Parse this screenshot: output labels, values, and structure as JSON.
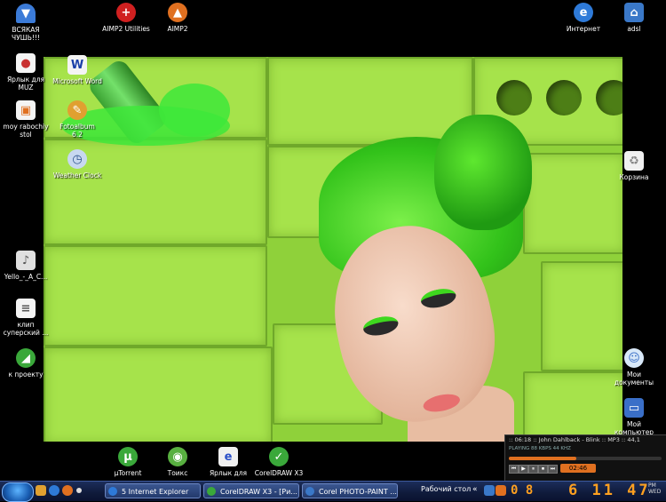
{
  "desktop_icons_left": [
    {
      "label": "ВСЯКАЯ\nЧУШЬ!!!",
      "icon": "blue-funnel-icon",
      "color": "#3b7bd8"
    },
    {
      "label": "Ярлык для\nMUZ",
      "icon": "shortcut-icon",
      "color": "#c83030"
    },
    {
      "label": "moy rabochiy\nstol",
      "icon": "document-icon",
      "color": "#e0a040"
    },
    {
      "label": "Yello_-_A_C...",
      "icon": "file-icon",
      "color": "#e0e0e0"
    },
    {
      "label": "клип\nсуперский ...",
      "icon": "text-file-icon",
      "color": "#f0f0f0"
    },
    {
      "label": "к проекту",
      "icon": "green-folder-icon",
      "color": "#3aa83a"
    }
  ],
  "desktop_icons_top": [
    {
      "label": "AIMP2 Utilities",
      "icon": "aimp-utilities-icon",
      "color": "#d02020"
    },
    {
      "label": "AIMP2",
      "icon": "aimp-icon",
      "color": "#e07020"
    },
    {
      "label": "Интернет",
      "icon": "internet-explorer-icon",
      "color": "#2e7ad8"
    },
    {
      "label": "adsl",
      "icon": "network-icon",
      "color": "#3a78c8"
    }
  ],
  "desktop_icons_wallpaper": [
    {
      "label": "Microsoft Word",
      "icon": "word-icon",
      "color": "#1a3fa8"
    },
    {
      "label": "Fotoalbum\n6.2",
      "icon": "photo-album-icon",
      "color": "#e0a030"
    },
    {
      "label": "Weather Clock",
      "icon": "weather-clock-icon",
      "color": "#c8d8f0"
    }
  ],
  "desktop_icons_right": [
    {
      "label": "Корзина",
      "icon": "recycle-bin-icon",
      "color": "#f0f0f0"
    },
    {
      "label": "Мои\nдокументы",
      "icon": "my-documents-icon",
      "color": "#d8e8f8"
    },
    {
      "label": "Мой\nкомпьютер",
      "icon": "my-computer-icon",
      "color": "#3a6fc8"
    }
  ],
  "desktop_icons_bottom": [
    {
      "label": "µTorrent",
      "icon": "utorrent-icon",
      "color": "#3aa83a"
    },
    {
      "label": "Тоикс",
      "icon": "toiks-icon",
      "color": "#58b040"
    },
    {
      "label": "Ярлык для",
      "icon": "shortcut-e-icon",
      "color": "#2a4fc8"
    },
    {
      "label": "CorelDRAW X3",
      "icon": "coreldraw-icon",
      "color": "#3aa83a"
    }
  ],
  "taskbar": {
    "tasks": [
      {
        "label": "5 Internet Explorer",
        "icon_color": "#2e7ad8"
      },
      {
        "label": "CorelDRAW X3 - [Ри...",
        "icon_color": "#3aa83a"
      },
      {
        "label": "Corel PHOTO-PAINT ...",
        "icon_color": "#3a78c8"
      }
    ],
    "toolbar_label": "Рабочий стол",
    "clock_time": "6 11 47",
    "clock_am_pm": "PM",
    "clock_day": "WED",
    "indicator_digits": "0 8"
  },
  "player": {
    "track_info": ":: 06:18 :: John Dahlback - Blink :: MP3 :: 44,1",
    "stats": "PLAYING    88 KBPS    44 KHZ",
    "time": "02:46",
    "buttons": [
      "⏮",
      "▶",
      "⏸",
      "⏹",
      "⏭"
    ]
  }
}
